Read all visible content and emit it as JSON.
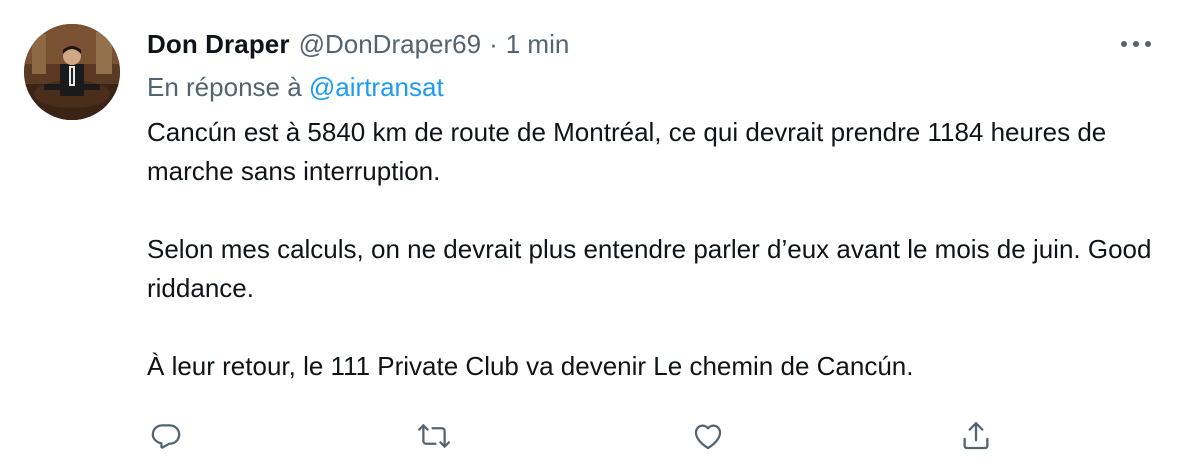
{
  "tweet": {
    "author_name": "Don Draper",
    "author_handle": "@DonDraper69",
    "separator": "·",
    "time": "1 min",
    "reply_prefix": "En réponse à",
    "reply_mention": "@airtransat",
    "paragraphs": [
      "Cancún est à 5840 km de route de Montréal, ce qui devrait prendre 1184 heures de marche sans interruption.",
      "Selon mes calculs, on ne devrait plus entendre parler d’eux avant le mois de juin. Good riddance.",
      "À leur retour, le 111 Private Club va devenir Le chemin de Cancún."
    ]
  },
  "icons": {
    "avatar": "avatar-photo",
    "more": "more-options-icon",
    "reply": "reply-icon",
    "retweet": "retweet-icon",
    "like": "like-heart-icon",
    "share": "share-icon"
  },
  "colors": {
    "text_primary": "#0f1419",
    "text_secondary": "#536471",
    "link": "#1d9bf0"
  }
}
